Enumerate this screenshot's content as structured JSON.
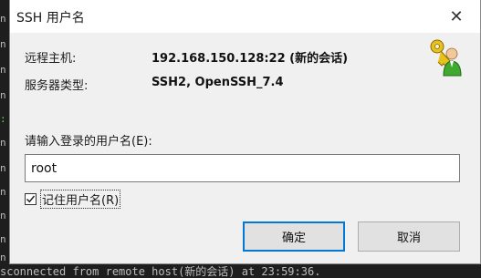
{
  "terminal": {
    "bottom_line": "sconnected from remote host(新的会话) at 23:59:36.",
    "left_fragments": [
      ":",
      "n",
      "n",
      "n",
      "n",
      "n",
      "n",
      "n",
      "n",
      "n",
      "n"
    ]
  },
  "dialog": {
    "title": "SSH 用户名",
    "close_glyph": "✕",
    "info": {
      "remote_host_label": "远程主机:",
      "remote_host_value": "192.168.150.128:22 (新的会话)",
      "server_type_label": "服务器类型:",
      "server_type_value": "SSH2, OpenSSH_7.4"
    },
    "prompt": "请输入登录的用户名(E):",
    "username_value": "root",
    "remember_label": "记住用户名(R)",
    "remember_checked": true,
    "ok_label": "确定",
    "cancel_label": "取消",
    "icon": "user-key-icon"
  }
}
